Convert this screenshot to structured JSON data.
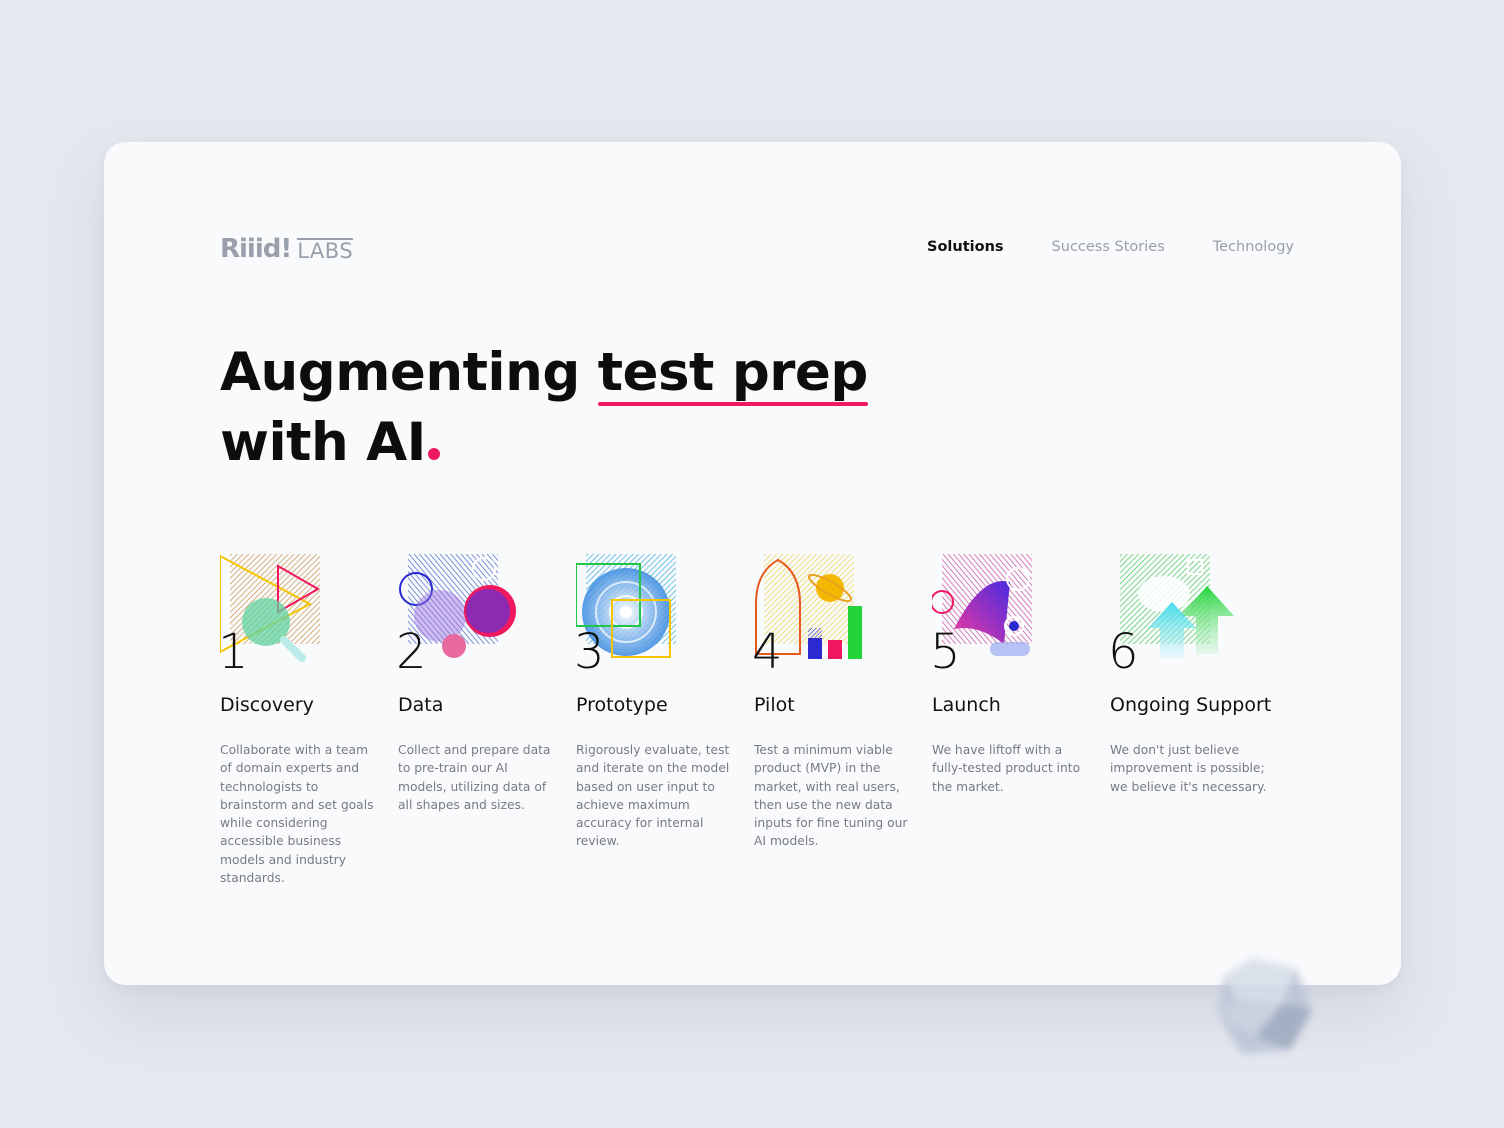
{
  "brand": {
    "logo_main": "Riiid!",
    "logo_sub": "LABS"
  },
  "nav": {
    "items": [
      "Solutions",
      "Success Stories",
      "Technology"
    ],
    "active": "Solutions"
  },
  "headline": {
    "line1_start": "Augmenting ",
    "line1_highlight": "test prep",
    "line2": "with AI"
  },
  "colors": {
    "accent": "#f0195f",
    "text": "#0d0d0d",
    "muted": "#777b82",
    "card": "#f9fafc",
    "background": "#e6e8ef"
  },
  "steps": [
    {
      "number": "1",
      "title": "Discovery",
      "description": "Collaborate with a team of domain experts and technologists to brainstorm and set goals while considering accessible business models and industry standards.",
      "icon": "discovery-illustration"
    },
    {
      "number": "2",
      "title": "Data",
      "description": "Collect and prepare data to pre-train our AI models, utilizing data of all shapes and sizes.",
      "icon": "data-illustration"
    },
    {
      "number": "3",
      "title": "Prototype",
      "description": "Rigorously evaluate, test and iterate on the model based on user input to achieve maximum accuracy for internal review.",
      "icon": "prototype-illustration"
    },
    {
      "number": "4",
      "title": "Pilot",
      "description": "Test a minimum viable product (MVP) in the market, with real users, then use the new data inputs for fine tuning our AI models.",
      "icon": "pilot-illustration"
    },
    {
      "number": "5",
      "title": "Launch",
      "description": "We have liftoff with a fully-tested product into the market.",
      "icon": "launch-illustration"
    },
    {
      "number": "6",
      "title": "Ongoing Support",
      "description": "We don't just believe improvement is possible; we believe it's necessary.",
      "icon": "support-illustration"
    }
  ]
}
